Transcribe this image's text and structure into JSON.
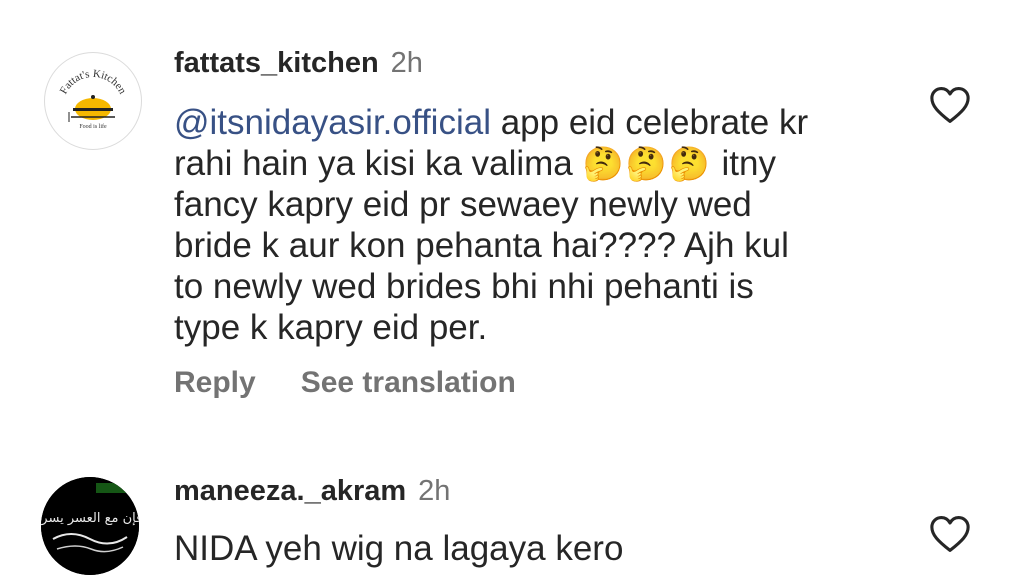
{
  "comments": [
    {
      "avatar": {
        "logo_text_top": "Fattat's Kitchen",
        "logo_text_bottom": "Food is life"
      },
      "username": "fattats_kitchen",
      "time": "2h",
      "mention": "@itsnidayasir.official",
      "text_line1_rest": " app eid celebrate kr",
      "text_line2a": "rahi hain ya kisi ka valima ",
      "emojis": "🤔🤔🤔",
      "text_line2b": " itny",
      "text_rest": "fancy kapry eid pr sewaey newly wed\nbride k aur kon pehanta hai???? Ajh kul\nto newly wed brides bhi nhi pehanti is\ntype k kapry eid per.",
      "reply_label": "Reply",
      "translate_label": "See translation",
      "like_icon": "heart-outline-icon"
    },
    {
      "avatar": {
        "image_text": "فإن مع العسر يسرا"
      },
      "username": "maneeza._akram",
      "time": "2h",
      "text": "NIDA yeh wig na lagaya kero",
      "like_icon": "heart-outline-icon"
    }
  ]
}
